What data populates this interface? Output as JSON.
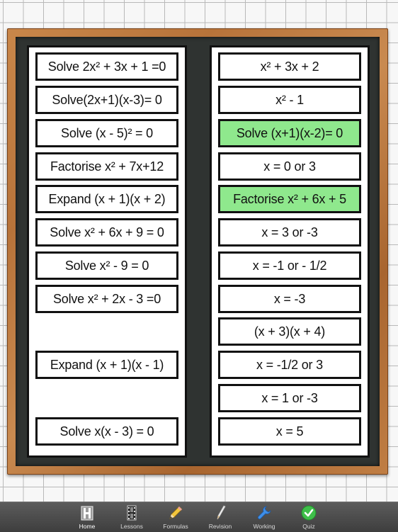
{
  "left_cards": [
    {
      "text": "Solve 2x² + 3x + 1 =0"
    },
    {
      "text": "Solve(2x+1)(x-3)= 0"
    },
    {
      "text": "Solve (x - 5)² = 0"
    },
    {
      "text": "Factorise x² + 7x+12"
    },
    {
      "text": "Expand (x + 1)(x + 2)"
    },
    {
      "text": "Solve x² + 6x + 9 = 0"
    },
    {
      "text": "Solve x² - 9 = 0"
    },
    {
      "text": "Solve x² + 2x - 3 =0"
    },
    {
      "text": "Expand (x + 1)(x - 1)"
    },
    {
      "text": "Solve x(x - 3) = 0"
    }
  ],
  "right_cards": [
    {
      "text": "x² + 3x + 2",
      "highlighted": false
    },
    {
      "text": "x² - 1",
      "highlighted": false
    },
    {
      "text": "Solve (x+1)(x-2)= 0",
      "highlighted": true
    },
    {
      "text": "x = 0 or 3",
      "highlighted": false
    },
    {
      "text": "Factorise x² + 6x + 5",
      "highlighted": true
    },
    {
      "text": "x = 3 or -3",
      "highlighted": false
    },
    {
      "text": "x = -1 or - 1/2",
      "highlighted": false
    },
    {
      "text": "x = -3",
      "highlighted": false
    },
    {
      "text": "(x + 3)(x + 4)",
      "highlighted": false
    },
    {
      "text": "x = -1/2 or 3",
      "highlighted": false
    },
    {
      "text": "x = 1 or -3",
      "highlighted": false
    },
    {
      "text": "x = 5",
      "highlighted": false
    }
  ],
  "toolbar": {
    "tabs": [
      {
        "label": "Home",
        "icon": "home-icon",
        "active": true
      },
      {
        "label": "Lessons",
        "icon": "film-icon",
        "active": false
      },
      {
        "label": "Formulas",
        "icon": "pencil-icon",
        "active": false
      },
      {
        "label": "Revision",
        "icon": "pen-icon",
        "active": false
      },
      {
        "label": "Working",
        "icon": "wrench-icon",
        "active": false
      },
      {
        "label": "Quiz",
        "icon": "checkmark-icon",
        "active": false
      }
    ]
  },
  "colors": {
    "highlight": "#8fe88d",
    "board_wood": "#b7733a",
    "board_surface": "#2f3331",
    "toolbar": "#4a4a4a"
  }
}
